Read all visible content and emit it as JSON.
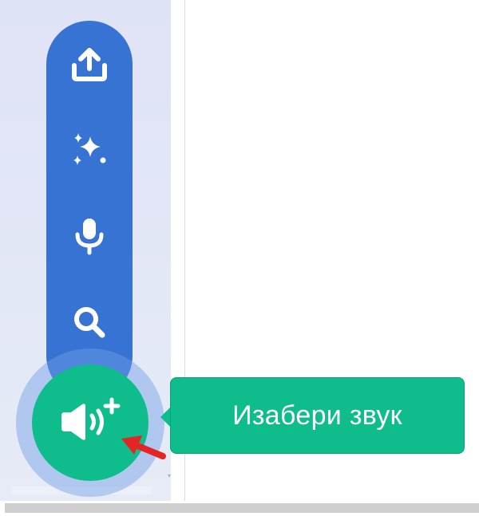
{
  "sound_menu": {
    "items": [
      {
        "icon": "upload-icon"
      },
      {
        "icon": "sparkles-icon"
      },
      {
        "icon": "microphone-icon"
      },
      {
        "icon": "search-icon"
      }
    ],
    "main_button_icon": "speaker-add-icon",
    "tooltip": "Изабери звук"
  },
  "colors": {
    "menu_blue": "#3773d2",
    "button_green": "#0fbd8c",
    "halo": "#9bbbef",
    "annotation_arrow": "#e52424"
  }
}
